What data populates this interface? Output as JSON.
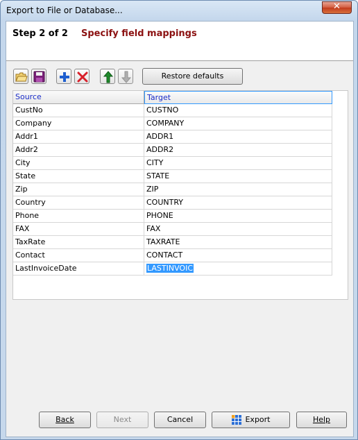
{
  "window": {
    "title": "Export to File or Database...",
    "close_glyph": "✕"
  },
  "header": {
    "step": "Step 2 of 2",
    "description": "Specify field mappings"
  },
  "toolbar": {
    "icons": [
      "open-folder-icon",
      "save-disk-icon",
      "add-plus-icon",
      "delete-x-icon",
      "move-up-arrow-icon",
      "move-down-arrow-icon"
    ],
    "restore_label": "Restore defaults"
  },
  "grid": {
    "columns": [
      "Source",
      "Target"
    ],
    "rows": [
      {
        "source": "CustNo",
        "target": "CUSTNO"
      },
      {
        "source": "Company",
        "target": "COMPANY"
      },
      {
        "source": "Addr1",
        "target": "ADDR1"
      },
      {
        "source": "Addr2",
        "target": "ADDR2"
      },
      {
        "source": "City",
        "target": "CITY"
      },
      {
        "source": "State",
        "target": "STATE"
      },
      {
        "source": "Zip",
        "target": "ZIP"
      },
      {
        "source": "Country",
        "target": "COUNTRY"
      },
      {
        "source": "Phone",
        "target": "PHONE"
      },
      {
        "source": "FAX",
        "target": "FAX"
      },
      {
        "source": "TaxRate",
        "target": "TAXRATE"
      },
      {
        "source": "Contact",
        "target": "CONTACT"
      },
      {
        "source": "LastInvoiceDate",
        "target": "LASTINVOIC"
      }
    ],
    "selected_row": 12
  },
  "buttons": {
    "back": "Back",
    "next": "Next",
    "cancel": "Cancel",
    "export": "Export",
    "help": "Help"
  },
  "colors": {
    "accent": "#3399ff",
    "step_desc": "#8b1010",
    "header_text": "#1a2cc8"
  }
}
